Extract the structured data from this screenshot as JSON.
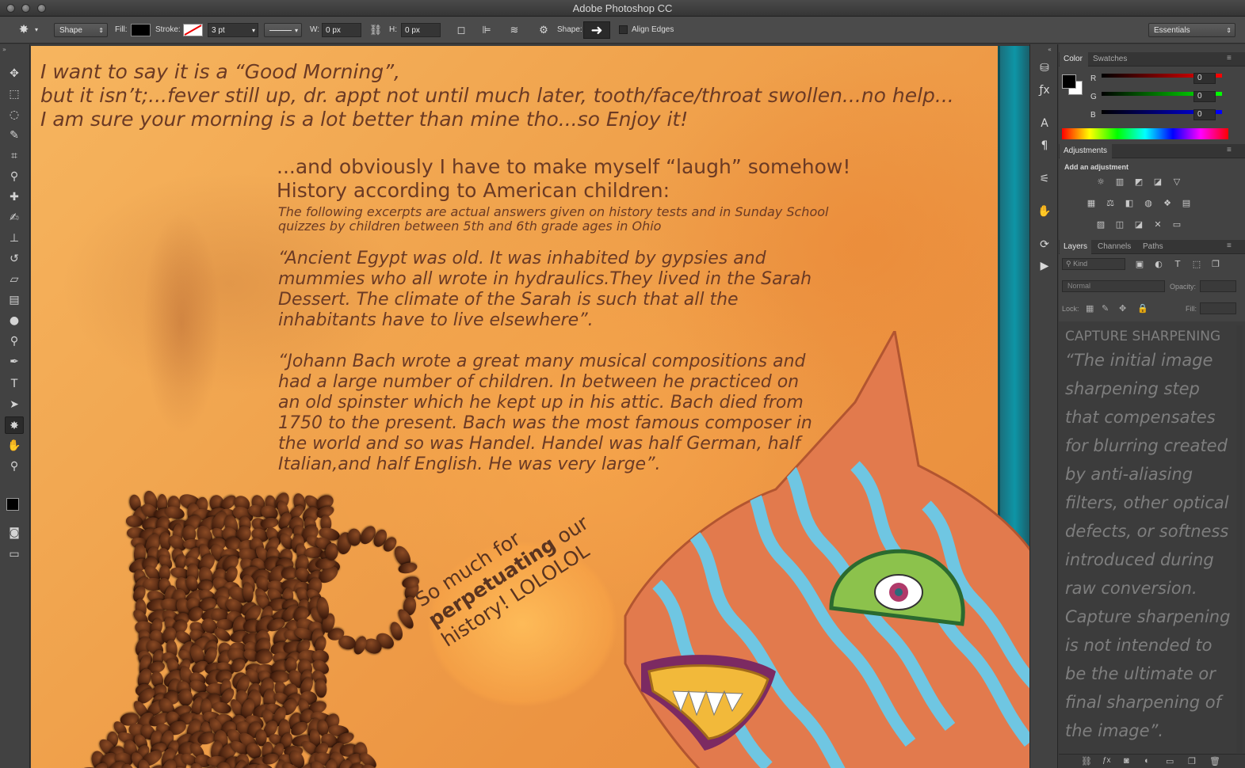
{
  "window": {
    "title": "Adobe Photoshop CC"
  },
  "optbar": {
    "mode": "Shape",
    "fill_label": "Fill:",
    "stroke_label": "Stroke:",
    "stroke_width": "3 pt",
    "w_label": "W:",
    "w_value": "0 px",
    "h_label": "H:",
    "h_value": "0 px",
    "shape_label": "Shape:",
    "align_edges": "Align Edges",
    "workspace": "Essentials"
  },
  "tools": [
    {
      "name": "move-tool",
      "icon": "✥"
    },
    {
      "name": "marquee-tool",
      "icon": "⬚"
    },
    {
      "name": "lasso-tool",
      "icon": "◌"
    },
    {
      "name": "quick-select-tool",
      "icon": "✎"
    },
    {
      "name": "crop-tool",
      "icon": "⌗"
    },
    {
      "name": "eyedropper-tool",
      "icon": "⚲"
    },
    {
      "name": "healing-tool",
      "icon": "✚"
    },
    {
      "name": "brush-tool",
      "icon": "✍"
    },
    {
      "name": "stamp-tool",
      "icon": "⊥"
    },
    {
      "name": "history-brush-tool",
      "icon": "↺"
    },
    {
      "name": "eraser-tool",
      "icon": "▱"
    },
    {
      "name": "gradient-tool",
      "icon": "▤"
    },
    {
      "name": "blur-tool",
      "icon": "●"
    },
    {
      "name": "dodge-tool",
      "icon": "⚲"
    },
    {
      "name": "pen-tool",
      "icon": "✒"
    },
    {
      "name": "type-tool",
      "icon": "T"
    },
    {
      "name": "path-select-tool",
      "icon": "➤"
    },
    {
      "name": "custom-shape-tool",
      "icon": "✸"
    },
    {
      "name": "hand-tool",
      "icon": "✋"
    },
    {
      "name": "zoom-tool",
      "icon": "⚲"
    }
  ],
  "canvas": {
    "intro_lines": [
      "I want to say it is a “Good Morning”,",
      "but it isn’t;...fever still up, dr. appt not until much later, tooth/face/throat swollen...no help...",
      "I am sure  your morning is a lot better than mine tho...so Enjoy it!"
    ],
    "laugh_line": "...and obviously I have to make myself “laugh” somehow!",
    "history_title": "History according to American children:",
    "excerpt_lines": [
      "The following excerpts are actual answers given on history tests and in Sunday School",
      "quizzes by children between 5th and 6th grade ages in Ohio"
    ],
    "egypt_lines": [
      "“Ancient Egypt was old. It was inhabited by gypsies and",
      "mummies who all wrote in hydraulics.They lived in the Sarah",
      "Dessert. The climate of the Sarah is such that all the",
      "inhabitants have to live elsewhere”."
    ],
    "bach_lines": [
      "“Johann Bach wrote a great many musical compositions and",
      "had a large number of children. In between he practiced on",
      "an old spinster which he kept up in his attic. Bach died from",
      "1750 to the present. Bach was the most famous composer in",
      "the world and so was Handel. Handel was half German, half",
      "Italian,and half English. He was very large”."
    ],
    "speech": {
      "line1": "So much for",
      "line2_bold": "perpetuating",
      "line2_rest": " our",
      "line3": "history! LOLOLOL"
    }
  },
  "color_panel": {
    "tabs": [
      "Color",
      "Swatches"
    ],
    "r_label": "R",
    "g_label": "G",
    "b_label": "B",
    "r_value": "0",
    "g_value": "0",
    "b_value": "0"
  },
  "adjustments_panel": {
    "tab": "Adjustments",
    "heading": "Add an adjustment"
  },
  "layers_panel": {
    "tabs": [
      "Layers",
      "Channels",
      "Paths"
    ],
    "kind_filter": "Kind",
    "blend_mode": "Normal",
    "opacity_label": "Opacity:",
    "lock_label": "Lock:",
    "fill_label": "Fill:",
    "text_heading": "CAPTURE SHARPENING",
    "text_lines": [
      "“The initial image",
      "sharpening step",
      "that compensates",
      "for blurring created",
      "by anti-aliasing",
      "filters, other optical",
      "defects, or softness",
      "introduced during",
      "raw conversion.",
      "Capture sharpening",
      "is not intended to",
      "be the ultimate or",
      "final sharpening of",
      "the image”."
    ]
  }
}
